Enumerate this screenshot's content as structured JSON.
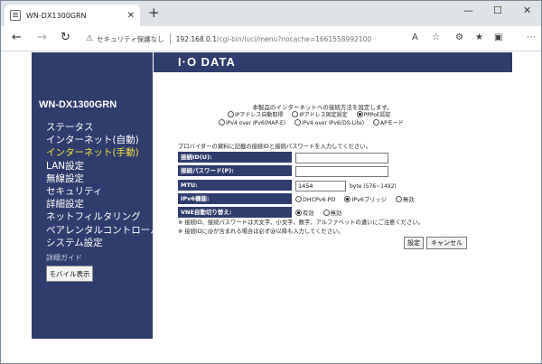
{
  "browser": {
    "tab_title": "WN-DX1300GRN",
    "tab_close": "✕",
    "new_tab": "+",
    "window_controls": {
      "minimize": "—",
      "maximize": "☐",
      "close": "✕"
    },
    "nav": {
      "back": "←",
      "forward": "→",
      "reload": "↻"
    },
    "security_text": "セキュリティ保護なし",
    "url_host": "192.168.0.1",
    "url_path": "/cgi-bin/luci/menu?nocache=1661558992100"
  },
  "banner": {
    "logo": "I·O DATA"
  },
  "sidebar": {
    "model": "WN-DX1300GRN",
    "items": [
      {
        "label": "ステータス",
        "active": false
      },
      {
        "label": "インターネット(自動)",
        "active": false
      },
      {
        "label": "インターネット(手動)",
        "active": true
      },
      {
        "label": "LAN設定",
        "active": false
      },
      {
        "label": "無線設定",
        "active": false
      },
      {
        "label": "セキュリティ",
        "active": false
      },
      {
        "label": "詳細設定",
        "active": false
      },
      {
        "label": "ネットフィルタリング",
        "active": false
      },
      {
        "label": "ペアレンタルコントロール",
        "active": false
      },
      {
        "label": "システム設定",
        "active": false
      }
    ],
    "guide_label": "詳細ガイド",
    "mobile_button": "モバイル表示"
  },
  "form": {
    "intro": "本製品のインターネットへの接続方法を設定します。",
    "connection_options": [
      {
        "label": "IPアドレス自動取得",
        "selected": false
      },
      {
        "label": "IPアドレス固定設定",
        "selected": false
      },
      {
        "label": "PPPoE認証",
        "selected": true
      },
      {
        "label": "IPv4 over IPv6(MAP-E)",
        "selected": false
      },
      {
        "label": "IPv4 over IPv6(DS-Lite)",
        "selected": false
      },
      {
        "label": "APモード",
        "selected": false
      }
    ],
    "provider_note": "プロバイダーの資料に記載の接続IDと接続パスワードを入力してください。",
    "connect_id_label": "接続ID(U):",
    "connect_id_value": "",
    "connect_password_label": "接続パスワード(P):",
    "connect_password_value": "",
    "mtu_label": "MTU:",
    "mtu_value": "1454",
    "mtu_hint": "byte (576~1492)",
    "ipv6_label": "IPv6機能:",
    "ipv6_options": [
      {
        "label": "DHCPv6-PD",
        "selected": false
      },
      {
        "label": "IPv6ブリッジ",
        "selected": true
      },
      {
        "label": "無効",
        "selected": false
      }
    ],
    "vne_label": "VNE自動切り替え:",
    "vne_options": [
      {
        "label": "有効",
        "selected": true
      },
      {
        "label": "無効",
        "selected": false
      }
    ],
    "note1": "※ 接続ID、接続パスワードは大文字、小文字、数字、アルファベットの違いにご注意ください。",
    "note2": "※ 接続IDに@が含まれる場合は必ず@以降も入力してください。",
    "submit_button": "設定",
    "cancel_button": "キャンセル"
  }
}
